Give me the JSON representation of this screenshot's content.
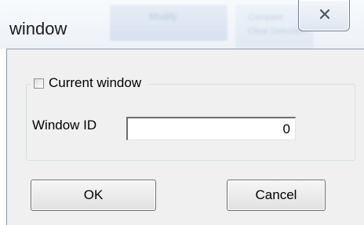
{
  "window": {
    "title": "window",
    "background_items": [
      "Modify",
      "Compare",
      "Clear Selection"
    ]
  },
  "group": {
    "checkbox_label": "Current window",
    "checkbox_checked": false
  },
  "fields": {
    "window_id_label": "Window ID",
    "window_id_value": "0"
  },
  "buttons": {
    "ok_label": "OK",
    "cancel_label": "Cancel"
  }
}
